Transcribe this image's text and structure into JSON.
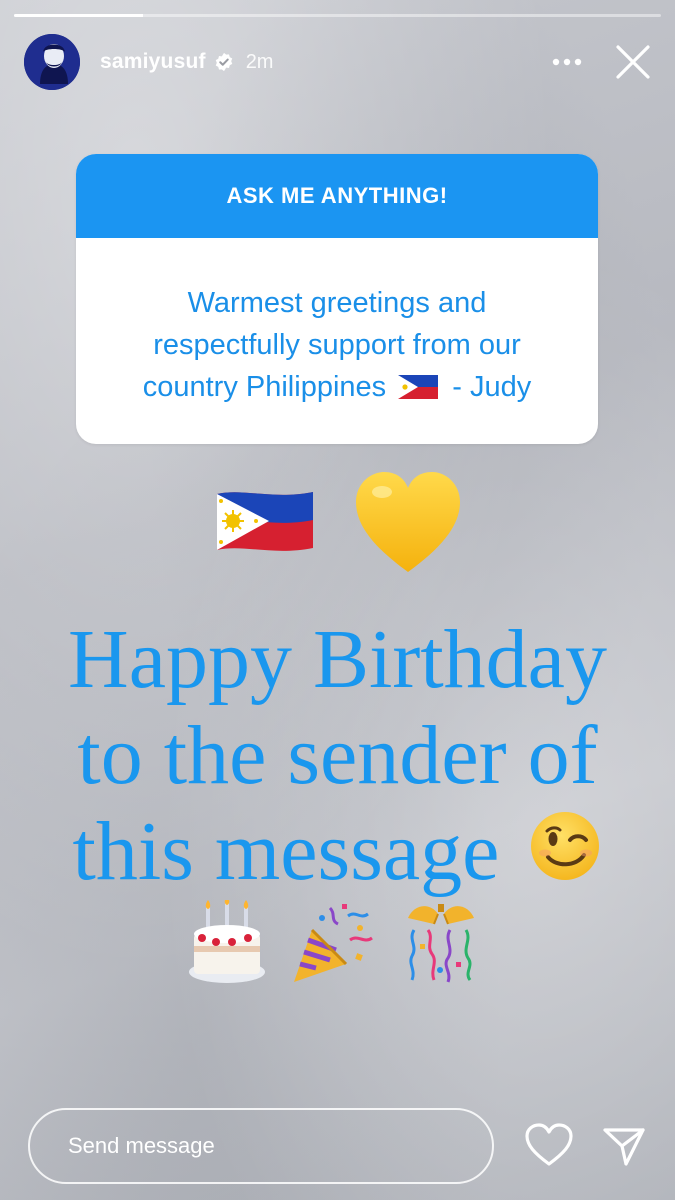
{
  "story": {
    "progress": 0.2,
    "username": "samiyusuf",
    "verified": true,
    "time_ago": "2m"
  },
  "question_sticker": {
    "header": "ASK ME ANYTHING!",
    "response_line1": "Warmest greetings and",
    "response_line2": "respectfully support from our",
    "response_line3_before": "country Philippines",
    "response_line3_after": "- Judy"
  },
  "emojis": [
    "philippines-flag",
    "yellow-heart",
    "winking-face",
    "birthday-cake",
    "party-popper",
    "confetti-ball"
  ],
  "caption": {
    "line1": "Happy Birthday",
    "line2": "to the sender of",
    "line3": "this message"
  },
  "footer": {
    "send_placeholder": "Send message"
  },
  "colors": {
    "accent_blue": "#1b95f2",
    "caption_blue": "#1a97ee",
    "verified_blue": "#3797f0",
    "heart_yellow": "#ffc928"
  }
}
